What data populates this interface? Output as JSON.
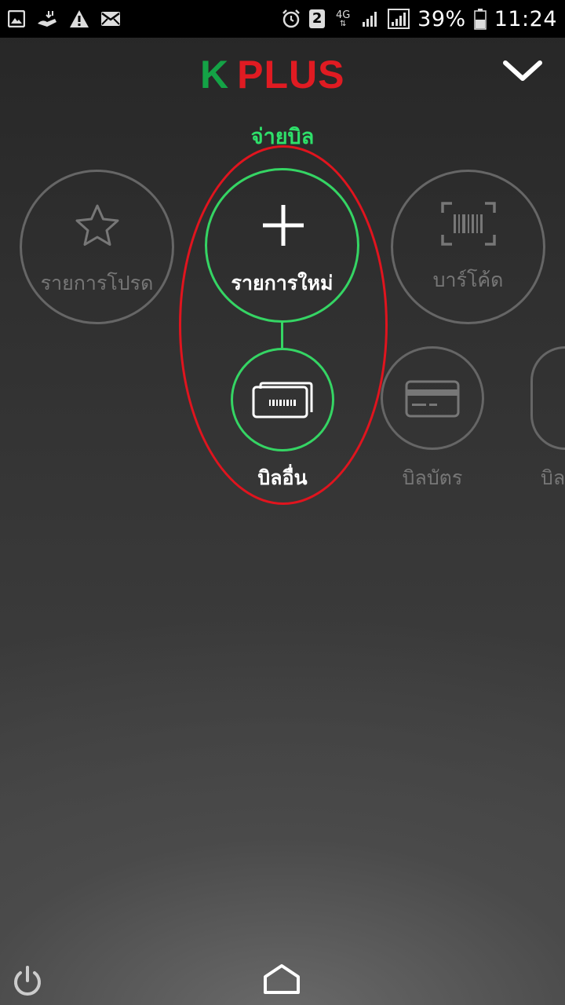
{
  "status_bar": {
    "battery": "39%",
    "time": "11:24",
    "sim_slot": "2",
    "network": "4G",
    "left_icons": [
      "image-icon",
      "download-icon",
      "warning-icon",
      "mail-icon"
    ],
    "right_icons": [
      "alarm-icon",
      "sim-icon",
      "network-4g-icon",
      "signal-icon",
      "signal-icon",
      "battery-icon"
    ]
  },
  "header": {
    "logo_k": "K",
    "logo_plus": "PLUS",
    "collapse_icon": "chevron-down-icon"
  },
  "menu": {
    "section_title": "จ่ายบิล",
    "favorites": {
      "label": "รายการโปรด",
      "icon": "star-icon"
    },
    "new_item": {
      "label": "รายการใหม่",
      "icon": "plus-icon"
    },
    "barcode": {
      "label": "บาร์โค้ด",
      "icon": "barcode-scan-icon"
    },
    "other_bill": {
      "label": "บิลอื่น",
      "icon": "bill-cards-icon"
    },
    "card_bill": {
      "label": "บิลบัตร",
      "icon": "credit-card-icon"
    },
    "partial_label": "บิล"
  },
  "colors": {
    "logo_green": "#14a346",
    "logo_red": "#e01b22",
    "accent_green": "#35d564",
    "title_green": "#2ee06a",
    "highlight_red": "#e0141e",
    "dim_gray": "#666666"
  },
  "nav": {
    "power_icon": "power-icon",
    "home_icon": "home-icon"
  }
}
